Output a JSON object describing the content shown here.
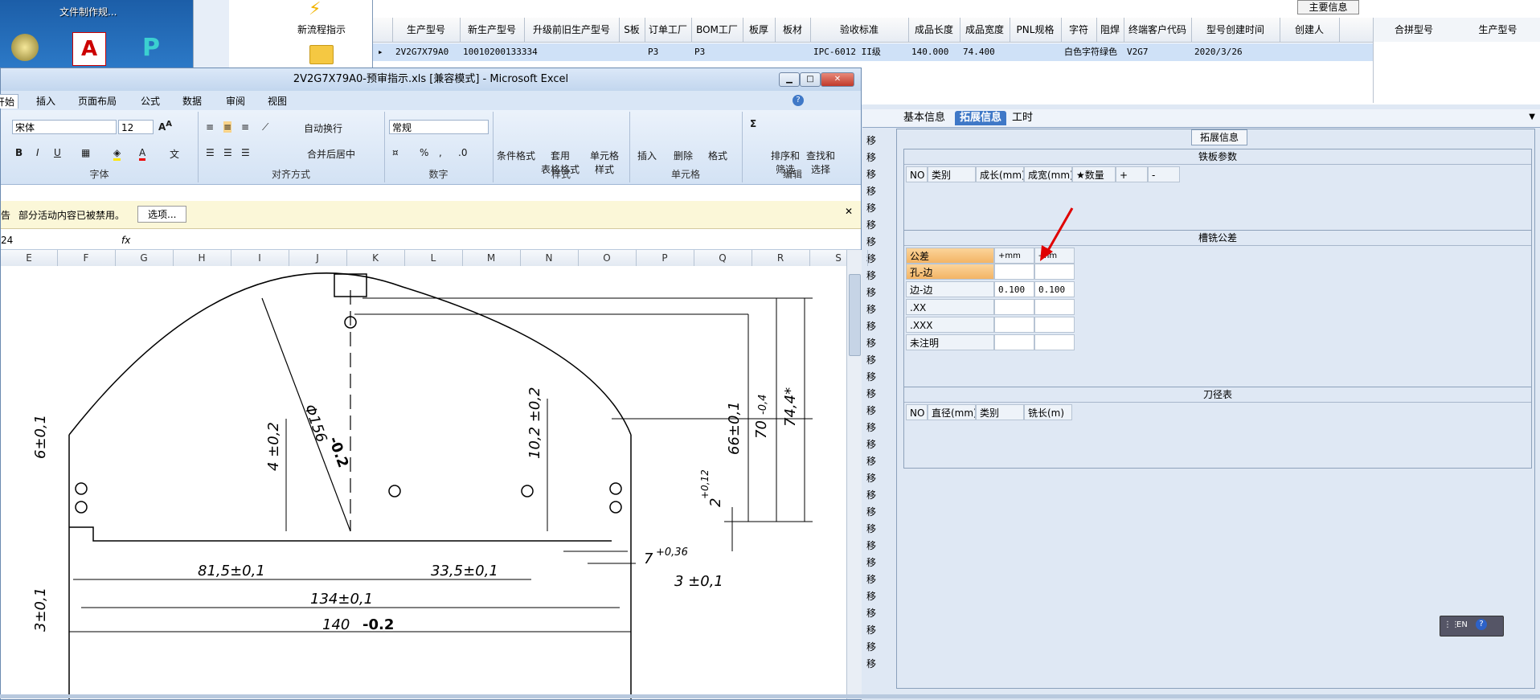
{
  "desktop": {
    "icon_label": "文件制作规...",
    "launcher_item": "新流程指示"
  },
  "top_grid": {
    "group_title": "主要信息",
    "columns": [
      "生产型号",
      "新生产型号",
      "升级前旧生产型号",
      "S板",
      "订单工厂",
      "BOM工厂",
      "板厚",
      "板材",
      "验收标准",
      "成品长度",
      "成品宽度",
      "PNL规格",
      "字符",
      "阻焊",
      "终端客户代码",
      "型号创建时间",
      "创建人"
    ],
    "row": [
      "2V2G7X79A0",
      "10010200133334",
      "",
      "",
      "P3",
      "P3",
      "",
      "",
      "IPC-6012 II级",
      "140.000",
      "74.400",
      "",
      "白色字符",
      "绿色",
      "V2G7",
      "2020/3/26",
      ""
    ],
    "side_columns": [
      "合拼型号",
      "生产型号"
    ]
  },
  "excel": {
    "title": "2V2G7X79A0-预审指示.xls [兼容模式] - Microsoft Excel",
    "tabs": [
      "开始",
      "插入",
      "页面布局",
      "公式",
      "数据",
      "审阅",
      "视图"
    ],
    "font_name": "宋体",
    "font_size": "12",
    "number_format": "常规",
    "wrap_text": "自动换行",
    "merge_center": "合并后居中",
    "groups": [
      "字体",
      "对齐方式",
      "数字",
      "样式",
      "单元格",
      "编辑"
    ],
    "style_buttons": [
      "条件格式",
      "套用\n表格格式",
      "单元格\n样式"
    ],
    "cell_buttons": [
      "插入",
      "删除",
      "格式"
    ],
    "edit_buttons": [
      "排序和\n筛选",
      "查找和\n选择"
    ],
    "msg_warn": "告",
    "msg_text": "部分活动内容已被禁用。",
    "msg_button": "选项...",
    "name_box": "24",
    "fx": "fx",
    "columns": [
      "E",
      "F",
      "G",
      "H",
      "I",
      "J",
      "K",
      "L",
      "M",
      "N",
      "O",
      "P",
      "Q",
      "R",
      "S"
    ],
    "dims": {
      "d1": "6±0,1",
      "d2": "4 ±0,2",
      "d3": "Φ156",
      "d3b": "-0.2",
      "d4": "10,2 ±0,2",
      "d5": "66±0,1",
      "d6": "70",
      "d6b": "-0,4",
      "d7": "74,4*",
      "d8": "2",
      "d8b": "+0,12",
      "d9": "7",
      "d9b": "+0,36",
      "d10": "3 ±0,1",
      "d11": "3±0,1",
      "d12": "81,5±0,1",
      "d13": "33,5±0,1",
      "d14": "134±0,1",
      "d15": "140",
      "d15b": "-0.2"
    }
  },
  "panel": {
    "tabs": [
      "基本信息",
      "拓展信息",
      "工时"
    ],
    "title": "拓展信息",
    "iron_board": {
      "title": "铁板参数",
      "cols": [
        "NO",
        "类别",
        "成长(mm)",
        "成宽(mm)",
        "★数量",
        "+",
        "-"
      ]
    },
    "slot_tolerance": {
      "title": "槽铣公差",
      "header": [
        "公差",
        "+mm",
        "-mm"
      ],
      "rows": [
        {
          "name": "孔-边",
          "plus": "",
          "minus": ""
        },
        {
          "name": "边-边",
          "plus": "0.100",
          "minus": "0.100"
        },
        {
          "name": ".XX",
          "plus": "",
          "minus": ""
        },
        {
          "name": ".XXX",
          "plus": "",
          "minus": ""
        },
        {
          "name": "未注明",
          "plus": "",
          "minus": ""
        }
      ]
    },
    "cutter": {
      "title": "刀径表",
      "cols": [
        "NO",
        "直径(mm)",
        "类别",
        "铣长(m)"
      ]
    },
    "side_chars": "移",
    "toolbar_label": "EN"
  },
  "colors": {
    "accent": "#3f78c7",
    "arrow": "#e00000",
    "selected_row": "#cfe1f7"
  }
}
